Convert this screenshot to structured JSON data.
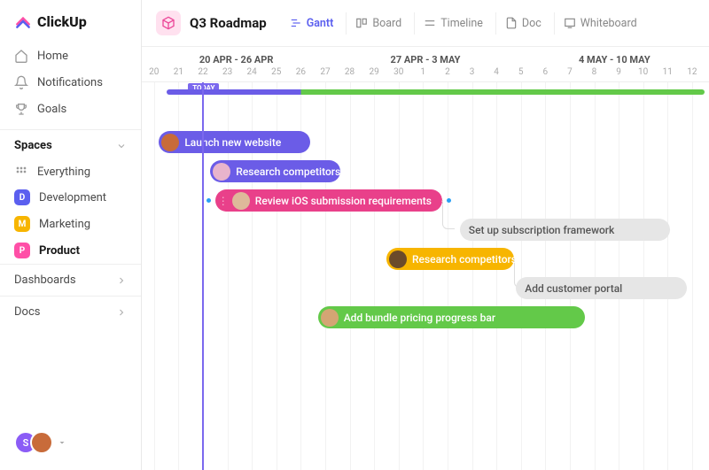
{
  "brand": "ClickUp",
  "nav": {
    "home": "Home",
    "notifications": "Notifications",
    "goals": "Goals"
  },
  "spaces": {
    "header": "Spaces",
    "everything": "Everything",
    "items": [
      {
        "letter": "D",
        "label": "Development",
        "color": "#5b5fef"
      },
      {
        "letter": "M",
        "label": "Marketing",
        "color": "#f7b500"
      },
      {
        "letter": "P",
        "label": "Product",
        "color": "#ff4fa7"
      }
    ]
  },
  "bottom": {
    "dashboards": "Dashboards",
    "docs": "Docs"
  },
  "page": {
    "title": "Q3 Roadmap",
    "views": {
      "gantt": "Gantt",
      "board": "Board",
      "timeline": "Timeline",
      "doc": "Doc",
      "whiteboard": "Whiteboard"
    }
  },
  "timeline": {
    "weeks": [
      "20 APR - 26 APR",
      "27 APR - 3 MAY",
      "4 MAY - 10 MAY"
    ],
    "days": [
      "20",
      "21",
      "22",
      "23",
      "24",
      "25",
      "26",
      "27",
      "28",
      "29",
      "30",
      "1",
      "2",
      "3",
      "4",
      "5",
      "6",
      "7",
      "8",
      "9",
      "10",
      "11",
      "12"
    ],
    "today_label": "TODAY",
    "today_index": 2
  },
  "tasks": [
    {
      "label": "Launch new website",
      "color": "#6b5ce7",
      "start": 0.7,
      "span": 6.2,
      "row": 0,
      "avatar": "#c86b3a"
    },
    {
      "label": "Research competitors",
      "color": "#6b5ce7",
      "start": 2.8,
      "span": 5.3,
      "row": 1,
      "avatar": "#e8b4cc"
    },
    {
      "label": "Review iOS submission requirements",
      "color": "#e9408a",
      "start": 3.0,
      "span": 9.3,
      "row": 2,
      "avatar": "#deb99a",
      "grips": true
    },
    {
      "label": "Set up subscription framework",
      "color": "#e6e6e6",
      "start": 13.0,
      "span": 8.6,
      "row": 3,
      "dim": true
    },
    {
      "label": "Research competitors",
      "color": "#f7b500",
      "start": 10.0,
      "span": 5.2,
      "row": 4,
      "avatar": "#6b4a2a"
    },
    {
      "label": "Add customer portal",
      "color": "#e6e6e6",
      "start": 15.3,
      "span": 7.0,
      "row": 5,
      "dim": true
    },
    {
      "label": "Add bundle pricing progress bar",
      "color": "#63c949",
      "start": 7.2,
      "span": 10.9,
      "row": 6,
      "avatar": "#d4a574"
    }
  ],
  "footer_avatars": [
    {
      "initial": "S",
      "bg": "#8b5cf6"
    },
    {
      "initial": "",
      "bg": "#c86b3a"
    }
  ]
}
